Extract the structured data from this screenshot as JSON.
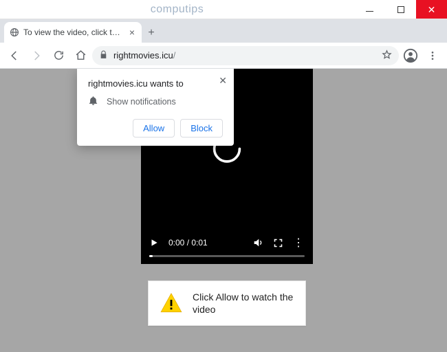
{
  "window": {
    "watermark": "computips"
  },
  "tab": {
    "title": "To view the video, click the Allow"
  },
  "toolbar": {
    "url_host": "rightmovies.icu",
    "url_path": "/"
  },
  "permission": {
    "origin_line": "rightmovies.icu wants to",
    "item": "Show notifications",
    "allow": "Allow",
    "block": "Block"
  },
  "video": {
    "time": "0:00 / 0:01"
  },
  "banner": {
    "text": "Click Allow to watch the video"
  }
}
